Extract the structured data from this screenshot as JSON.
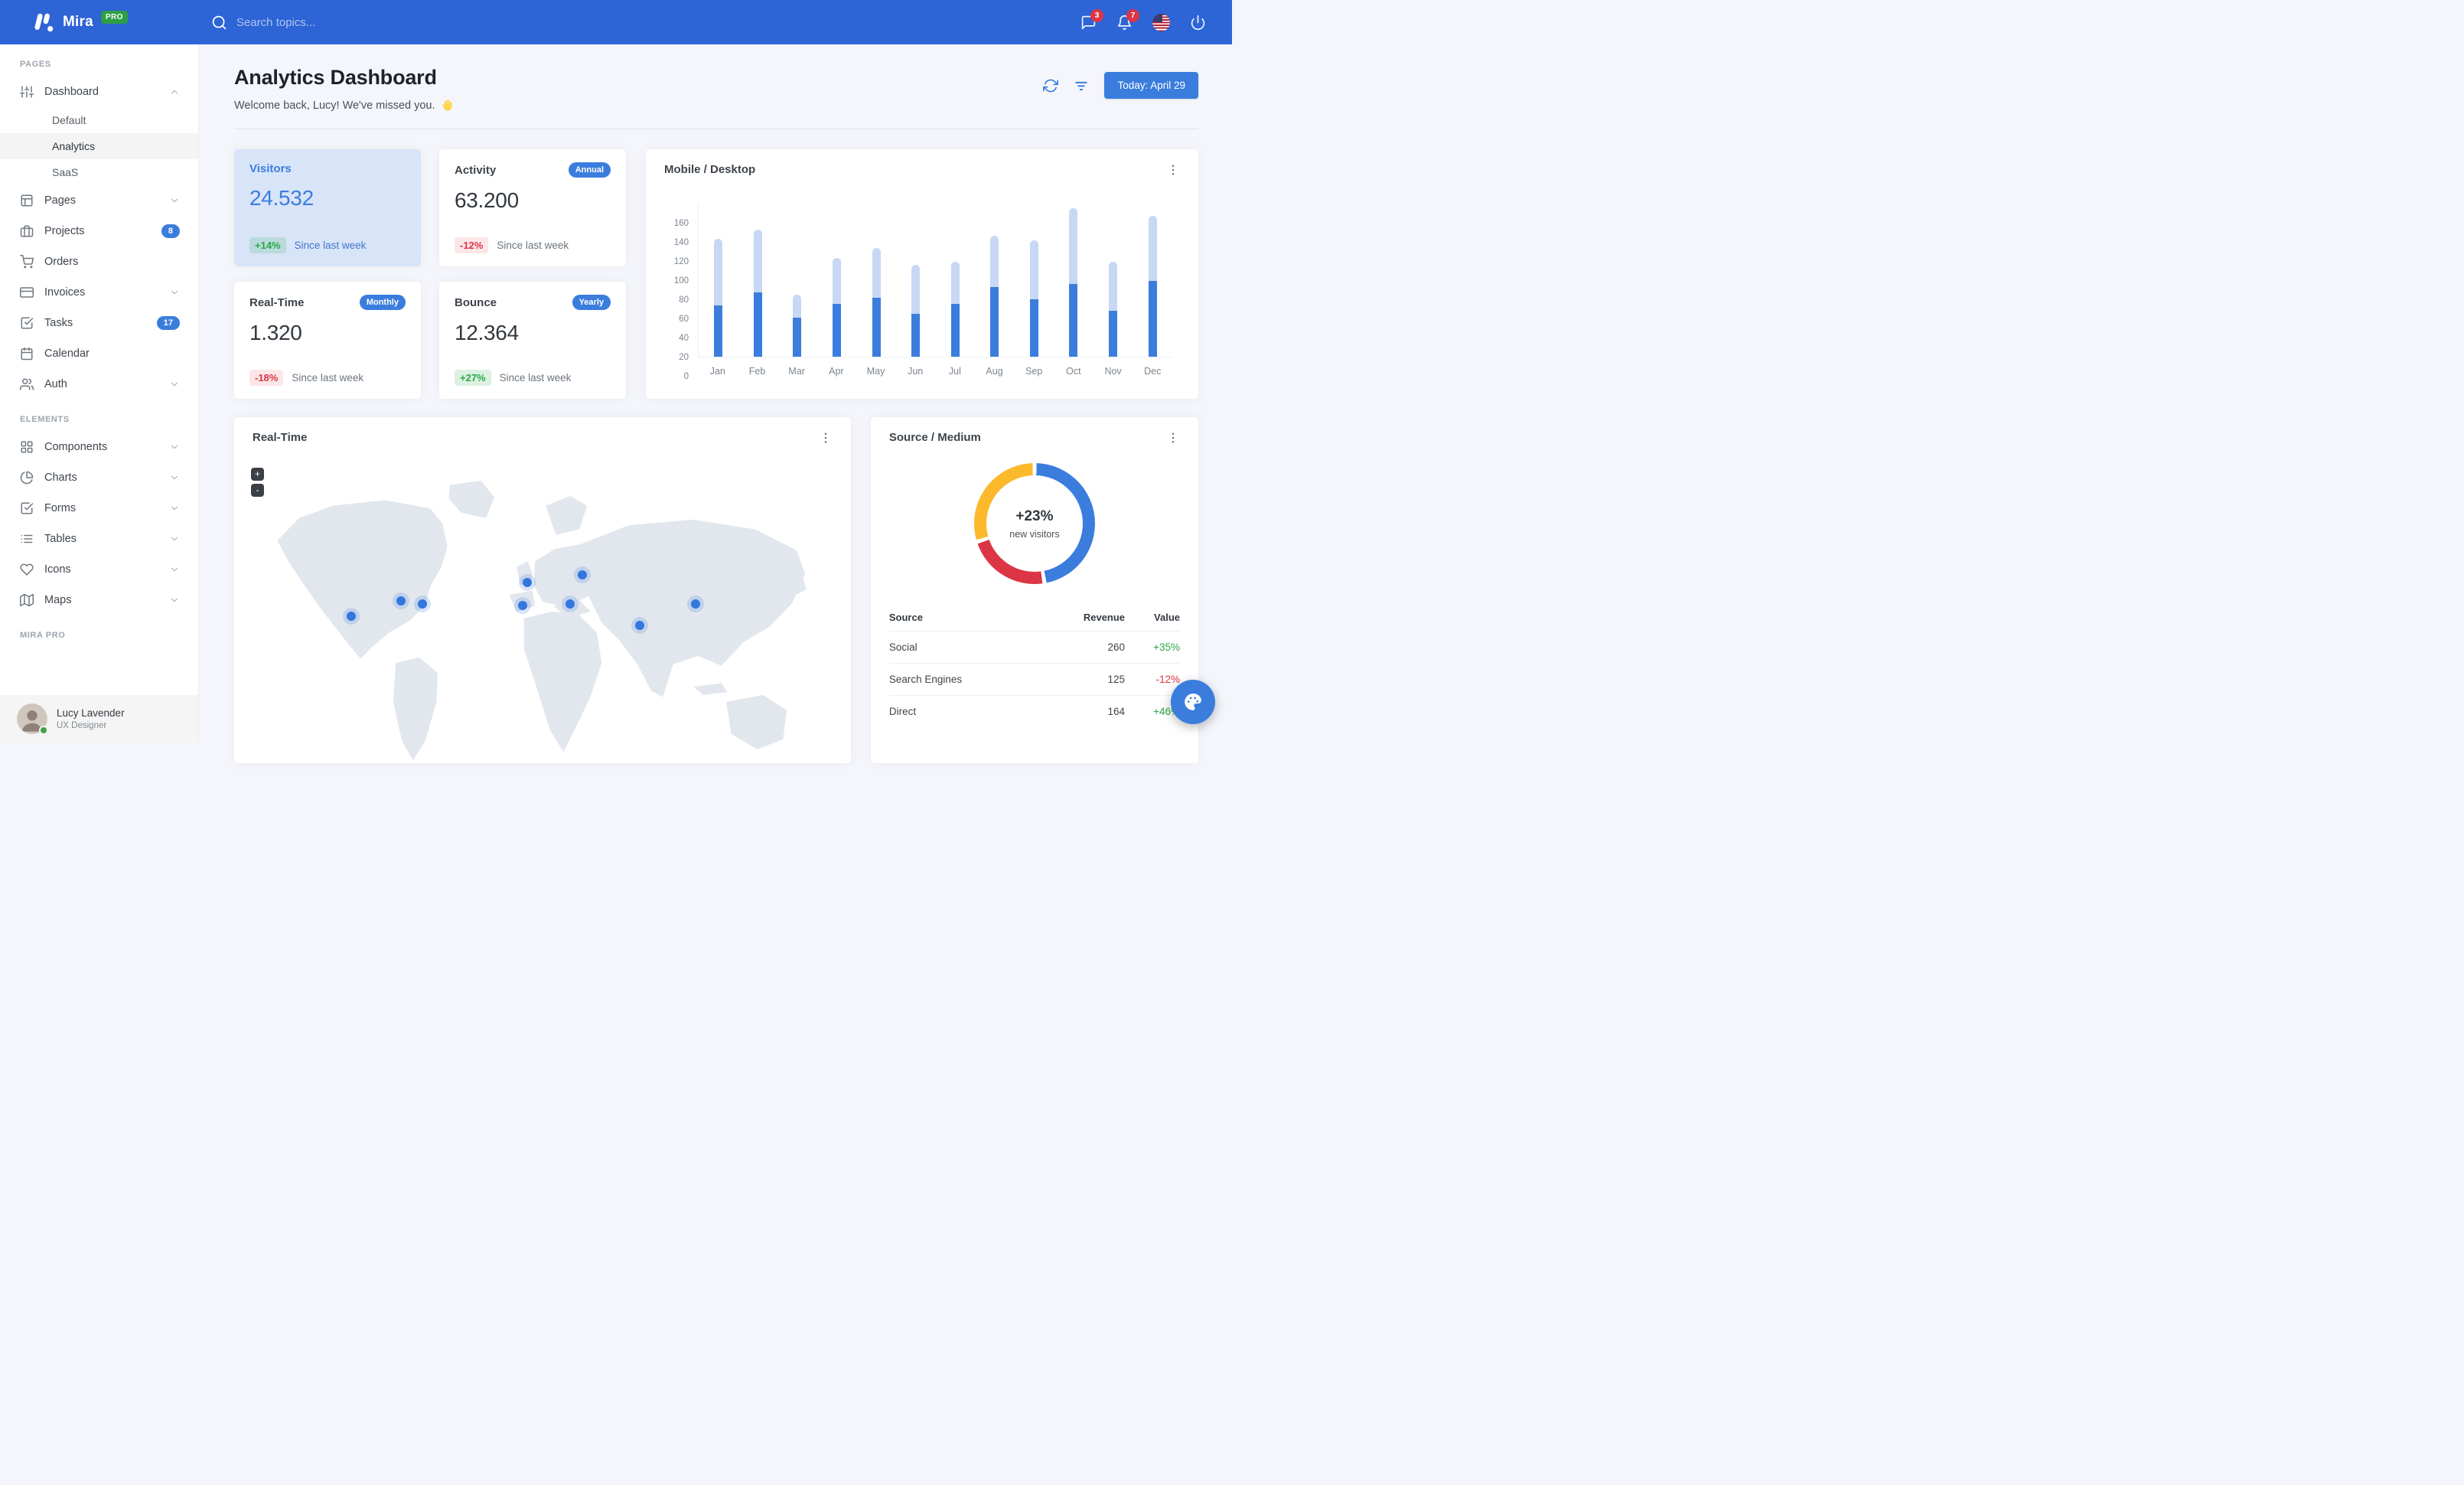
{
  "theme": {
    "navbar_blue": "#2D64D6",
    "primary_blue": "#3B7DDD",
    "success_green": "#28a745",
    "danger_red": "#dc3545",
    "warning_orange": "#fcb92c",
    "bar_light_blue": "#C7D8F4",
    "page_bg": "#F4F6FB"
  },
  "navbar": {
    "brand": "Mira",
    "brand_badge": "PRO",
    "search_placeholder": "Search topics...",
    "messages_badge": "3",
    "notifications_badge": "7"
  },
  "sidebar": {
    "sections": [
      {
        "label": "Pages",
        "items": [
          {
            "label": "Dashboard",
            "icon": "sliders-icon",
            "chevron": "up",
            "expanded": true,
            "children": [
              {
                "label": "Default",
                "active": false
              },
              {
                "label": "Analytics",
                "active": true
              },
              {
                "label": "SaaS",
                "active": false
              }
            ]
          },
          {
            "label": "Pages",
            "icon": "layout-icon",
            "chevron": "down"
          },
          {
            "label": "Projects",
            "icon": "briefcase-icon",
            "badge": "8"
          },
          {
            "label": "Orders",
            "icon": "cart-icon"
          },
          {
            "label": "Invoices",
            "icon": "credit-card-icon",
            "chevron": "down"
          },
          {
            "label": "Tasks",
            "icon": "check-square-icon",
            "badge": "17"
          },
          {
            "label": "Calendar",
            "icon": "calendar-icon"
          },
          {
            "label": "Auth",
            "icon": "users-icon",
            "chevron": "down"
          }
        ]
      },
      {
        "label": "Elements",
        "items": [
          {
            "label": "Components",
            "icon": "grid-icon",
            "chevron": "down"
          },
          {
            "label": "Charts",
            "icon": "pie-chart-icon",
            "chevron": "down"
          },
          {
            "label": "Forms",
            "icon": "check-square-icon",
            "chevron": "down"
          },
          {
            "label": "Tables",
            "icon": "list-icon",
            "chevron": "down"
          },
          {
            "label": "Icons",
            "icon": "heart-icon",
            "chevron": "down"
          },
          {
            "label": "Maps",
            "icon": "map-icon",
            "chevron": "down"
          }
        ]
      },
      {
        "label": "Mira Pro",
        "items": []
      }
    ],
    "user": {
      "name": "Lucy Lavender",
      "role": "UX Designer",
      "status": "online"
    }
  },
  "header": {
    "title": "Analytics Dashboard",
    "subtitle": "Welcome back, Lucy! We've missed you.",
    "subtitle_emoji": "👋",
    "date_button": "Today: April 29"
  },
  "stats": [
    {
      "title": "Visitors",
      "value": "24.532",
      "delta": "+14%",
      "delta_tone": "success",
      "note": "Since last week",
      "variant": "primary"
    },
    {
      "title": "Activity",
      "value": "63.200",
      "badge": "Annual",
      "delta": "-12%",
      "delta_tone": "danger",
      "note": "Since last week"
    },
    {
      "title": "Real-Time",
      "value": "1.320",
      "badge": "Monthly",
      "delta": "-18%",
      "delta_tone": "danger",
      "note": "Since last week"
    },
    {
      "title": "Bounce",
      "value": "12.364",
      "badge": "Yearly",
      "delta": "+27%",
      "delta_tone": "success",
      "note": "Since last week"
    }
  ],
  "chart_data": [
    {
      "type": "bar",
      "title": "Mobile / Desktop",
      "stacked": true,
      "categories": [
        "Jan",
        "Feb",
        "Mar",
        "Apr",
        "May",
        "Jun",
        "Jul",
        "Aug",
        "Sep",
        "Oct",
        "Nov",
        "Dec"
      ],
      "series": [
        {
          "name": "Mobile",
          "color": "#3B7DDD",
          "values": [
            54,
            67,
            41,
            55,
            62,
            45,
            55,
            73,
            60,
            76,
            48,
            79
          ]
        },
        {
          "name": "Desktop",
          "color": "#C7D8F4",
          "values": [
            69,
            66,
            24,
            48,
            52,
            51,
            44,
            53,
            62,
            79,
            51,
            68
          ]
        }
      ],
      "ylim": [
        0,
        160
      ],
      "yticks": [
        0,
        20,
        40,
        60,
        80,
        100,
        120,
        140,
        160
      ],
      "grid": false,
      "legend": "none"
    },
    {
      "type": "pie",
      "title": "Source / Medium",
      "donut": true,
      "center_value": "+23%",
      "center_label": "new visitors",
      "slices": [
        {
          "label": "Social",
          "value": 260,
          "color": "#3B7DDD"
        },
        {
          "label": "Search Engines",
          "value": 125,
          "color": "#dc3545"
        },
        {
          "label": "Direct",
          "value": 164,
          "color": "#fcb92c"
        }
      ]
    },
    {
      "type": "table",
      "title": "Source / Medium",
      "columns": [
        "Source",
        "Revenue",
        "Value"
      ],
      "rows": [
        [
          "Social",
          "260",
          "+35%"
        ],
        [
          "Search Engines",
          "125",
          "-12%"
        ],
        [
          "Direct",
          "164",
          "+46%"
        ]
      ]
    }
  ],
  "map_card": {
    "title": "Real-Time",
    "zoom_in_label": "+",
    "zoom_out_label": "-",
    "markers": [
      {
        "x": 19.0,
        "y": 52.0
      },
      {
        "x": 27.0,
        "y": 47.0
      },
      {
        "x": 30.5,
        "y": 48.0
      },
      {
        "x": 47.5,
        "y": 41.0
      },
      {
        "x": 46.8,
        "y": 48.5
      },
      {
        "x": 56.5,
        "y": 38.5
      },
      {
        "x": 54.5,
        "y": 48.0
      },
      {
        "x": 65.8,
        "y": 55.0
      },
      {
        "x": 74.8,
        "y": 48.0
      }
    ]
  }
}
